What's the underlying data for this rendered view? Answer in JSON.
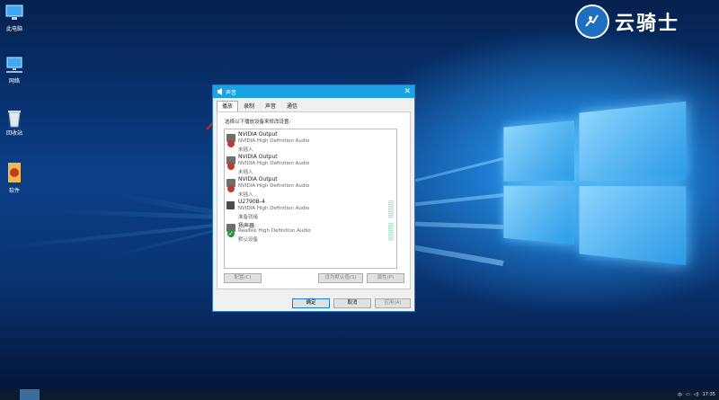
{
  "desktop": {
    "icons": [
      {
        "label": "此电脑"
      },
      {
        "label": "网络"
      },
      {
        "label": "回收站"
      },
      {
        "label": "软件"
      }
    ],
    "brand_text": "云骑士"
  },
  "dialog": {
    "title": "声音",
    "close": "✕",
    "tabs": [
      {
        "label": "播放"
      },
      {
        "label": "录制"
      },
      {
        "label": "声音"
      },
      {
        "label": "通信"
      }
    ],
    "instruction": "选择以下播放设备来修改设置:",
    "devices": [
      {
        "name": "NVIDIA Output",
        "subtitle": "NVIDIA High Definition Audio",
        "status": "未插入"
      },
      {
        "name": "NVIDIA Output",
        "subtitle": "NVIDIA High Definition Audio",
        "status": "未插入"
      },
      {
        "name": "NVIDIA Output",
        "subtitle": "NVIDIA High Definition Audio",
        "status": "未插入"
      },
      {
        "name": "U2790B-4",
        "subtitle": "NVIDIA High Definition Audio",
        "status": "准备就绪"
      },
      {
        "name": "扬声器",
        "subtitle": "Realtek High Definition Audio",
        "status": "默认设备"
      }
    ],
    "buttons": {
      "configure": "配置(C)",
      "set_default": "设为默认值(S)",
      "properties": "属性(P)",
      "ok": "确定",
      "cancel": "取消",
      "apply": "应用(A)"
    }
  },
  "taskbar": {
    "ime": "中",
    "time": "17:35"
  }
}
